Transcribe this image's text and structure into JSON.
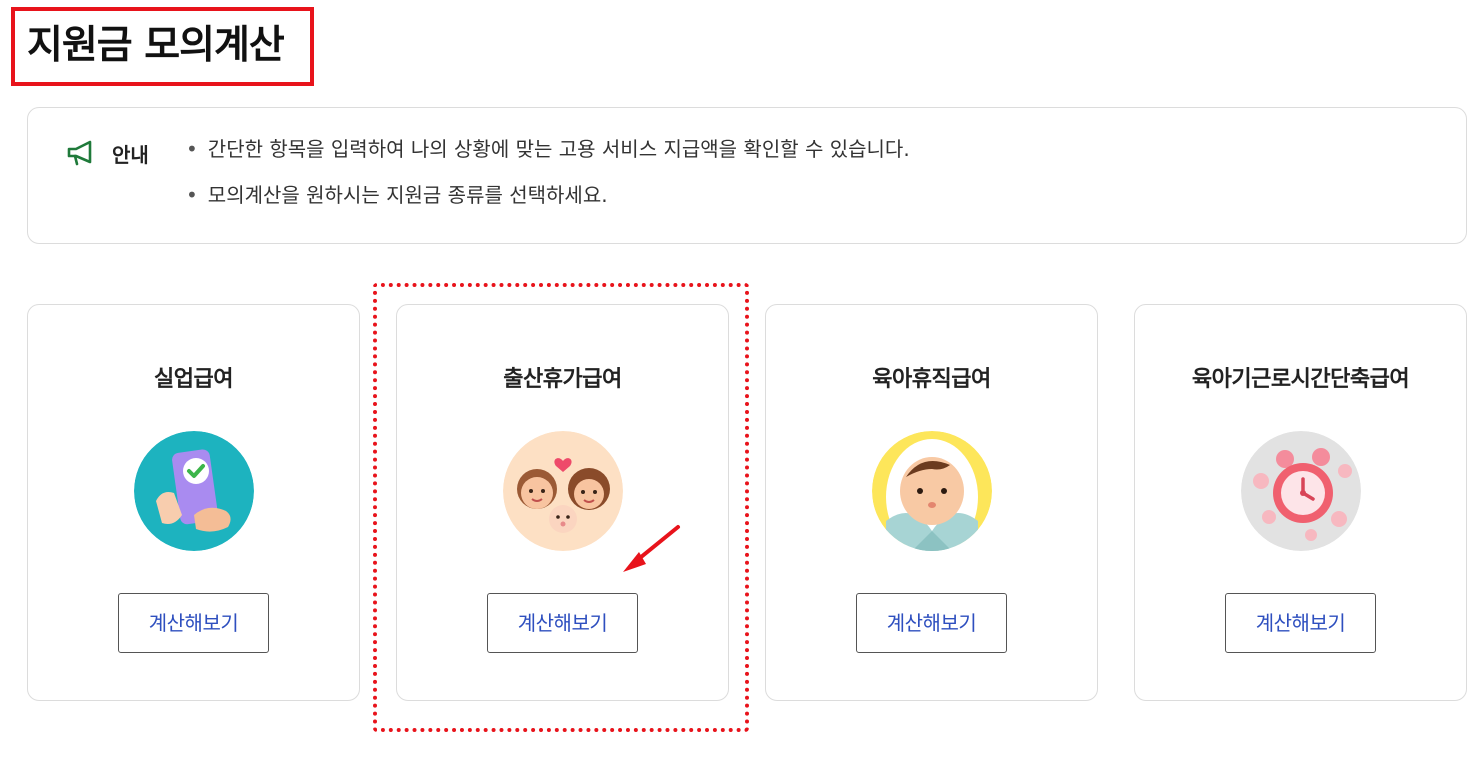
{
  "page_title": "지원금 모의계산",
  "notice": {
    "icon": "megaphone-icon",
    "label": "안내",
    "items": [
      "간단한 항목을 입력하여 나의 상황에 맞는 고용 서비스 지급액을 확인할 수 있습니다.",
      "모의계산을 원하시는 지원금 종류를 선택하세요."
    ]
  },
  "cards": [
    {
      "title": "실업급여",
      "button_label": "계산해보기",
      "image": "phone-check-icon",
      "image_bg": "#1db3bf"
    },
    {
      "title": "출산휴가급여",
      "button_label": "계산해보기",
      "image": "family-icon",
      "image_bg": "#fde0c4"
    },
    {
      "title": "육아휴직급여",
      "button_label": "계산해보기",
      "image": "baby-icon",
      "image_bg": "#fde65a"
    },
    {
      "title": "육아기근로시간단축급여",
      "button_label": "계산해보기",
      "image": "alarm-clock-coins-icon",
      "image_bg": "#e2e2e2"
    }
  ],
  "colors": {
    "highlight_red": "#e8131b",
    "button_text_blue": "#2e4fbf",
    "megaphone_green": "#1f7a3a"
  }
}
